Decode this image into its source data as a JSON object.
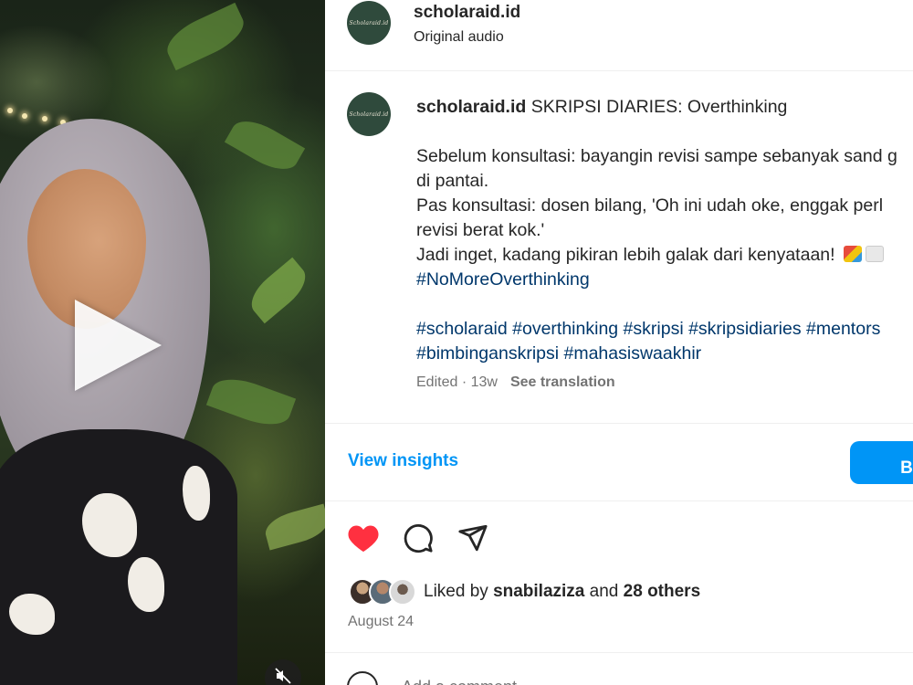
{
  "video": {
    "play_icon": "play-icon",
    "mute_icon": "muted-speaker-icon"
  },
  "header": {
    "username": "scholaraid.id",
    "audio": "Original audio",
    "avatar_text": "Scholaraid.id"
  },
  "caption": {
    "username": "scholaraid.id",
    "title": "SKRIPSI DIARIES: Overthinking",
    "lines": [
      "Sebelum konsultasi: bayangin revisi sampe sebanyak sand g",
      "di pantai.",
      "Pas konsultasi: dosen bilang, 'Oh ini udah oke, enggak perl",
      "revisi berat kok.'",
      "Jadi inget, kadang pikiran lebih galak dari kenyataan!"
    ],
    "hashtag_line1": "#NoMoreOverthinking",
    "hashtag_line2": "#scholaraid #overthinking #skripsi #skripsidiaries #mentors",
    "hashtag_line3": "#bimbinganskripsi #mahasiswaakhir",
    "meta": "Edited · 13w",
    "see_translation": "See translation"
  },
  "actions": {
    "view_insights": "View insights",
    "boost": "Boost",
    "like_icon": "heart-icon",
    "comment_icon": "comment-icon",
    "share_icon": "paper-plane-icon",
    "like_color": "#ff3040"
  },
  "likes": {
    "prefix": "Liked by",
    "user": "snabilaziza",
    "middle": "and",
    "others": "28 others"
  },
  "date": "August 24",
  "comment": {
    "placeholder": "Add a comment..."
  }
}
